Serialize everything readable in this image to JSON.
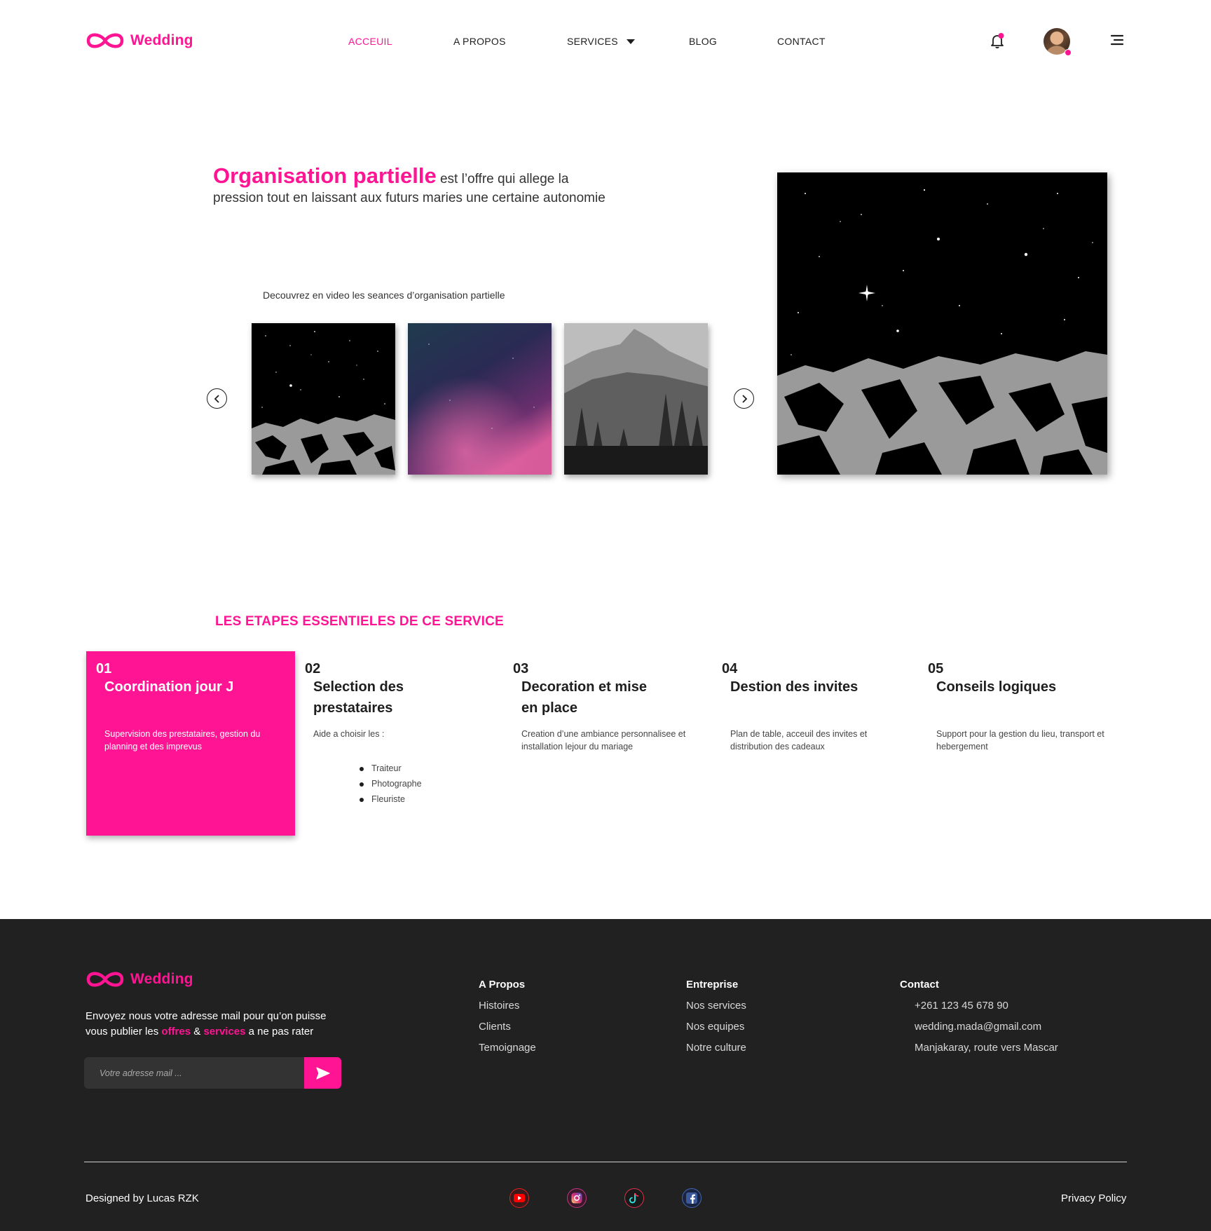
{
  "header": {
    "brand": "Wedding",
    "nav": [
      {
        "label": "ACCEUIL",
        "active": true
      },
      {
        "label": "A PROPOS"
      },
      {
        "label": "SERVICES"
      },
      {
        "label": "BLOG"
      },
      {
        "label": "CONTACT"
      }
    ],
    "icons": [
      "bell-icon",
      "avatar",
      "menu-icon"
    ]
  },
  "hero": {
    "title": "Organisation partielle",
    "text_after_title": " est l’offre qui allege la pression tout en laissant aux futurs maries une certaine autonomie",
    "video_caption": "Decouvrez en video les seances d’organisation partielle",
    "carousel_prev_icon": "chevron-left-icon",
    "carousel_next_icon": "chevron-right-icon"
  },
  "steps": {
    "title": "LES ETAPES ESSENTIELES DE CE SERVICE",
    "items": [
      {
        "num": "01",
        "title": "Coordination jour J",
        "desc": "Supervision des prestataires, gestion du planning et des imprevus",
        "active": true
      },
      {
        "num": "02",
        "title": "Selection des prestataires",
        "desc": "Aide a choisir les :",
        "bullets": [
          "Traiteur",
          "Photographe",
          "Fleuriste"
        ]
      },
      {
        "num": "03",
        "title": "Decoration et mise en place",
        "desc": "Creation d’une ambiance personnalisee et installation lejour du mariage"
      },
      {
        "num": "04",
        "title": "Destion des invites",
        "desc": "Plan de table, acceuil des invites et distribution des cadeaux"
      },
      {
        "num": "05",
        "title": "Conseils logiques",
        "desc": "Support pour la gestion du lieu, transport et hebergement"
      }
    ]
  },
  "footer": {
    "brand": "Wedding",
    "newsletter_text_1": "Envoyez nous votre adresse mail pour qu’on puisse vous publier les ",
    "newsletter_highlight_1": "offres",
    "newsletter_amp": " & ",
    "newsletter_highlight_2": "services",
    "newsletter_text_2": " a ne pas rater",
    "email_placeholder": "Votre adresse mail ...",
    "columns": [
      {
        "title": "A Propos",
        "links": [
          "Histoires",
          "Clients",
          "Temoignage"
        ]
      },
      {
        "title": "Entreprise",
        "links": [
          "Nos services",
          "Nos equipes",
          "Notre culture"
        ]
      },
      {
        "title": "Contact",
        "links": [
          "+261 123 45 678 90",
          "wedding.mada@gmail.com",
          "Manjakaray, route vers Mascar"
        ]
      }
    ],
    "designed_by": "Designed by Lucas RZK",
    "privacy": "Privacy Policy",
    "social": [
      "youtube-icon",
      "instagram-icon",
      "tiktok-icon",
      "facebook-icon"
    ]
  },
  "colors": {
    "accent": "#ff1493",
    "footer_bg": "#212121"
  }
}
